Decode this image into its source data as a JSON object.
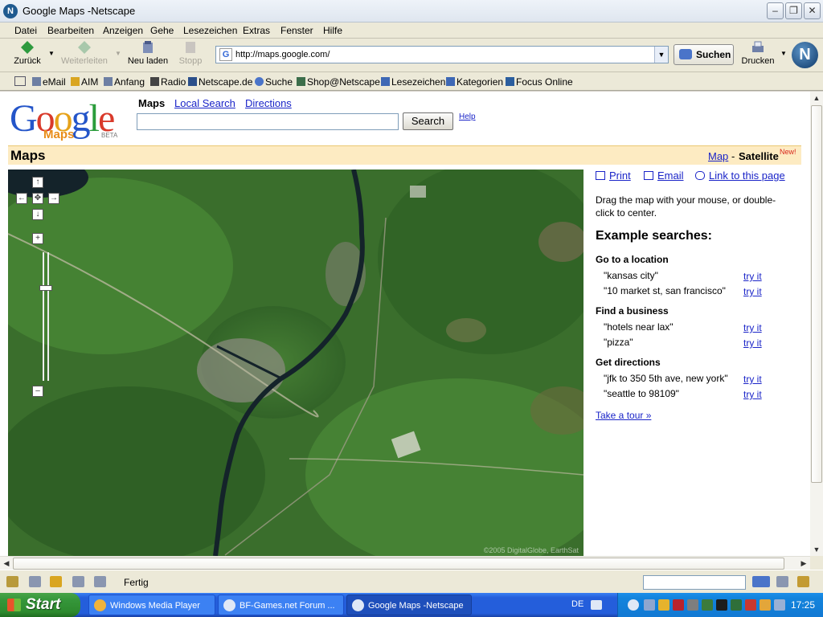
{
  "window": {
    "title": "Google Maps -Netscape"
  },
  "menu": [
    "Datei",
    "Bearbeiten",
    "Anzeigen",
    "Gehe",
    "Lesezeichen",
    "Extras",
    "Fenster",
    "Hilfe"
  ],
  "nav": {
    "back": "Zurück",
    "forward": "Weiterleiten",
    "reload": "Neu laden",
    "stop": "Stopp",
    "url": "http://maps.google.com/",
    "search_button": "Suchen",
    "print": "Drucken"
  },
  "personal_toolbar": [
    "eMail",
    "AIM",
    "Anfang",
    "Radio",
    "Netscape.de",
    "Suche",
    "Shop@Netscape",
    "Lesezeichen",
    "Kategorien",
    "Focus Online"
  ],
  "google": {
    "logo": {
      "letters": [
        "G",
        "o",
        "o",
        "g",
        "l",
        "e"
      ],
      "maps": "Maps",
      "beta": "BETA"
    },
    "tabs": {
      "maps": "Maps",
      "local": "Local Search",
      "directions": "Directions"
    },
    "search_button": "Search",
    "help": "Help",
    "bar_title": "Maps",
    "view": {
      "map": "Map",
      "separator": "-",
      "satellite": "Satellite",
      "new_badge": "New!"
    }
  },
  "side_panel": {
    "print": "Print",
    "email": "Email",
    "link": "Link to this page",
    "instructions": "Drag the map with your mouse, or double-click to center.",
    "heading": "Example searches:",
    "groups": [
      {
        "title": "Go to a location",
        "items": [
          "\"kansas city\"",
          "\"10 market st, san francisco\""
        ]
      },
      {
        "title": "Find a business",
        "items": [
          "\"hotels near lax\"",
          "\"pizza\""
        ]
      },
      {
        "title": "Get directions",
        "items": [
          "\"jfk to 350 5th ave, new york\"",
          "\"seattle to 98109\""
        ]
      }
    ],
    "try_label": "try it",
    "tour": "Take a tour »"
  },
  "map": {
    "copyright": "©2005 DigitalGlobe, EarthSat"
  },
  "status": {
    "text": "Fertig"
  },
  "taskbar": {
    "start": "Start",
    "tasks": [
      "Windows Media Player",
      "BF-Games.net Forum ...",
      "Google Maps -Netscape"
    ],
    "language": "DE",
    "time": "17:25"
  },
  "colors": {
    "link": "#1a24c8",
    "maps_bar": "#fdebc2",
    "taskbar": "#245edb"
  }
}
